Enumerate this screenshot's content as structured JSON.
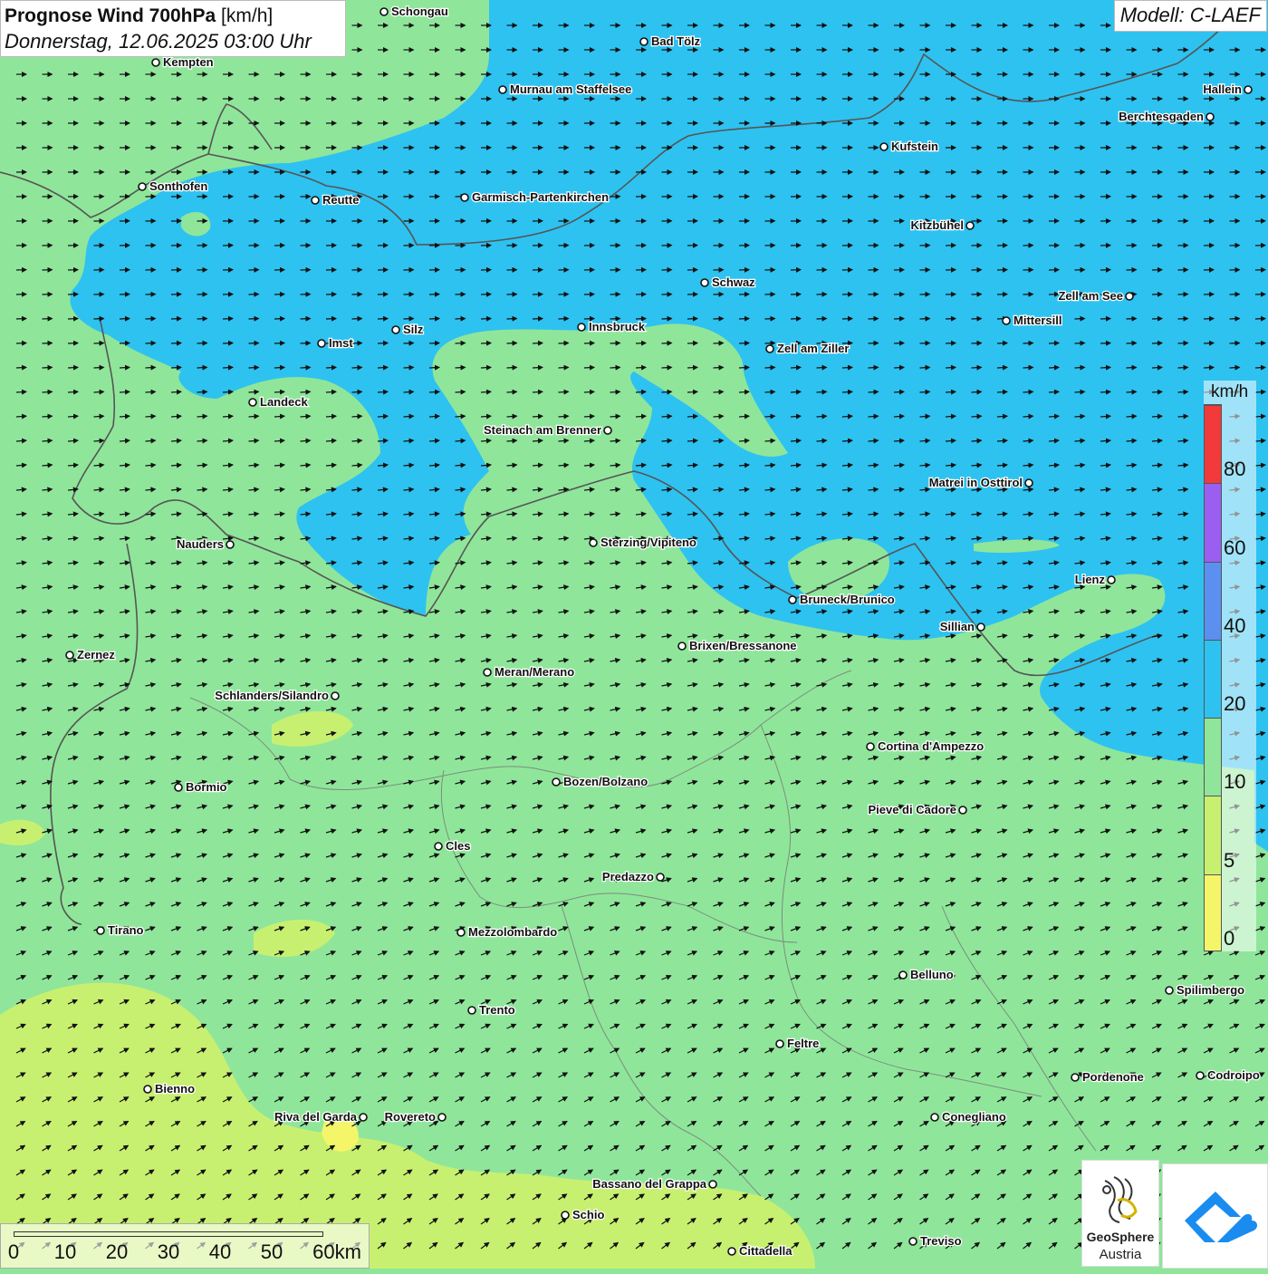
{
  "header": {
    "title_bold": "Prognose Wind 700hPa",
    "title_unit": "[km/h]",
    "datetime": "Donnerstag, 12.06.2025 03:00 Uhr"
  },
  "model_label": "Modell: C-LAEF",
  "legend": {
    "unit": "km/h",
    "classes": [
      {
        "from": 0,
        "to": 5,
        "color": "#f5f56a"
      },
      {
        "from": 5,
        "to": 10,
        "color": "#c8f070"
      },
      {
        "from": 10,
        "to": 20,
        "color": "#8fe69a"
      },
      {
        "from": 20,
        "to": 40,
        "color": "#2ec2f0"
      },
      {
        "from": 40,
        "to": 60,
        "color": "#5c90f0"
      },
      {
        "from": 60,
        "to": 80,
        "color": "#9a5ef0"
      },
      {
        "from": 80,
        "to": 100,
        "color": "#f23a3a"
      }
    ],
    "labels": [
      "0",
      "5",
      "10",
      "20",
      "40",
      "60",
      "80"
    ]
  },
  "scale_bar": {
    "ticks": [
      "0",
      "10",
      "20",
      "30",
      "40",
      "50",
      "60km"
    ]
  },
  "logos": {
    "geosphere_line1": "GeoSphere",
    "geosphere_line2": "Austria"
  },
  "cities": [
    {
      "name": "Schongau",
      "anchor": "start"
    },
    {
      "name": "Kempten",
      "anchor": "start"
    },
    {
      "name": "Bad Tölz",
      "anchor": "start"
    },
    {
      "name": "Murnau am Staffelsee",
      "anchor": "start"
    },
    {
      "name": "Hallein",
      "anchor": "end"
    },
    {
      "name": "Berchtesgaden",
      "anchor": "end"
    },
    {
      "name": "Kufstein",
      "anchor": "start"
    },
    {
      "name": "Sonthofen",
      "anchor": "start"
    },
    {
      "name": "Reutte",
      "anchor": "start"
    },
    {
      "name": "Garmisch-Partenkirchen",
      "anchor": "start"
    },
    {
      "name": "Kitzbühel",
      "anchor": "end"
    },
    {
      "name": "Schwaz",
      "anchor": "start"
    },
    {
      "name": "Zell am See",
      "anchor": "end"
    },
    {
      "name": "Mittersill",
      "anchor": "start"
    },
    {
      "name": "Imst",
      "anchor": "start"
    },
    {
      "name": "Silz",
      "anchor": "start"
    },
    {
      "name": "Innsbruck",
      "anchor": "start"
    },
    {
      "name": "Zell am Ziller",
      "anchor": "start"
    },
    {
      "name": "Landeck",
      "anchor": "start"
    },
    {
      "name": "Steinach am Brenner",
      "anchor": "end"
    },
    {
      "name": "Matrei in Osttirol",
      "anchor": "end"
    },
    {
      "name": "Nauders",
      "anchor": "end"
    },
    {
      "name": "Sterzing/Vipiteno",
      "anchor": "start"
    },
    {
      "name": "Lienz",
      "anchor": "end"
    },
    {
      "name": "Bruneck/Brunico",
      "anchor": "start"
    },
    {
      "name": "Sillian",
      "anchor": "end"
    },
    {
      "name": "Zernez",
      "anchor": "start"
    },
    {
      "name": "Brixen/Bressanone",
      "anchor": "start"
    },
    {
      "name": "Meran/Merano",
      "anchor": "start"
    },
    {
      "name": "Schlanders/Silandro",
      "anchor": "end"
    },
    {
      "name": "Cortina d'Ampezzo",
      "anchor": "start"
    },
    {
      "name": "Bozen/Bolzano",
      "anchor": "start"
    },
    {
      "name": "Bormio",
      "anchor": "start"
    },
    {
      "name": "Pieve di Cadore",
      "anchor": "end"
    },
    {
      "name": "Cles",
      "anchor": "start"
    },
    {
      "name": "Predazzo",
      "anchor": "end"
    },
    {
      "name": "Tirano",
      "anchor": "start"
    },
    {
      "name": "Mezzolombardo",
      "anchor": "start"
    },
    {
      "name": "Belluno",
      "anchor": "start"
    },
    {
      "name": "Spilimbergo",
      "anchor": "start"
    },
    {
      "name": "Trento",
      "anchor": "start"
    },
    {
      "name": "Feltre",
      "anchor": "start"
    },
    {
      "name": "Pordenone",
      "anchor": "start"
    },
    {
      "name": "Codroipo",
      "anchor": "start"
    },
    {
      "name": "Bienno",
      "anchor": "start"
    },
    {
      "name": "Riva del Garda",
      "anchor": "end"
    },
    {
      "name": "Rovereto",
      "anchor": "end"
    },
    {
      "name": "Conegliano",
      "anchor": "start"
    },
    {
      "name": "Bassano del Grappa",
      "anchor": "end"
    },
    {
      "name": "Schio",
      "anchor": "start"
    },
    {
      "name": "Treviso",
      "anchor": "start"
    },
    {
      "name": "Cittadella",
      "anchor": "start"
    }
  ]
}
